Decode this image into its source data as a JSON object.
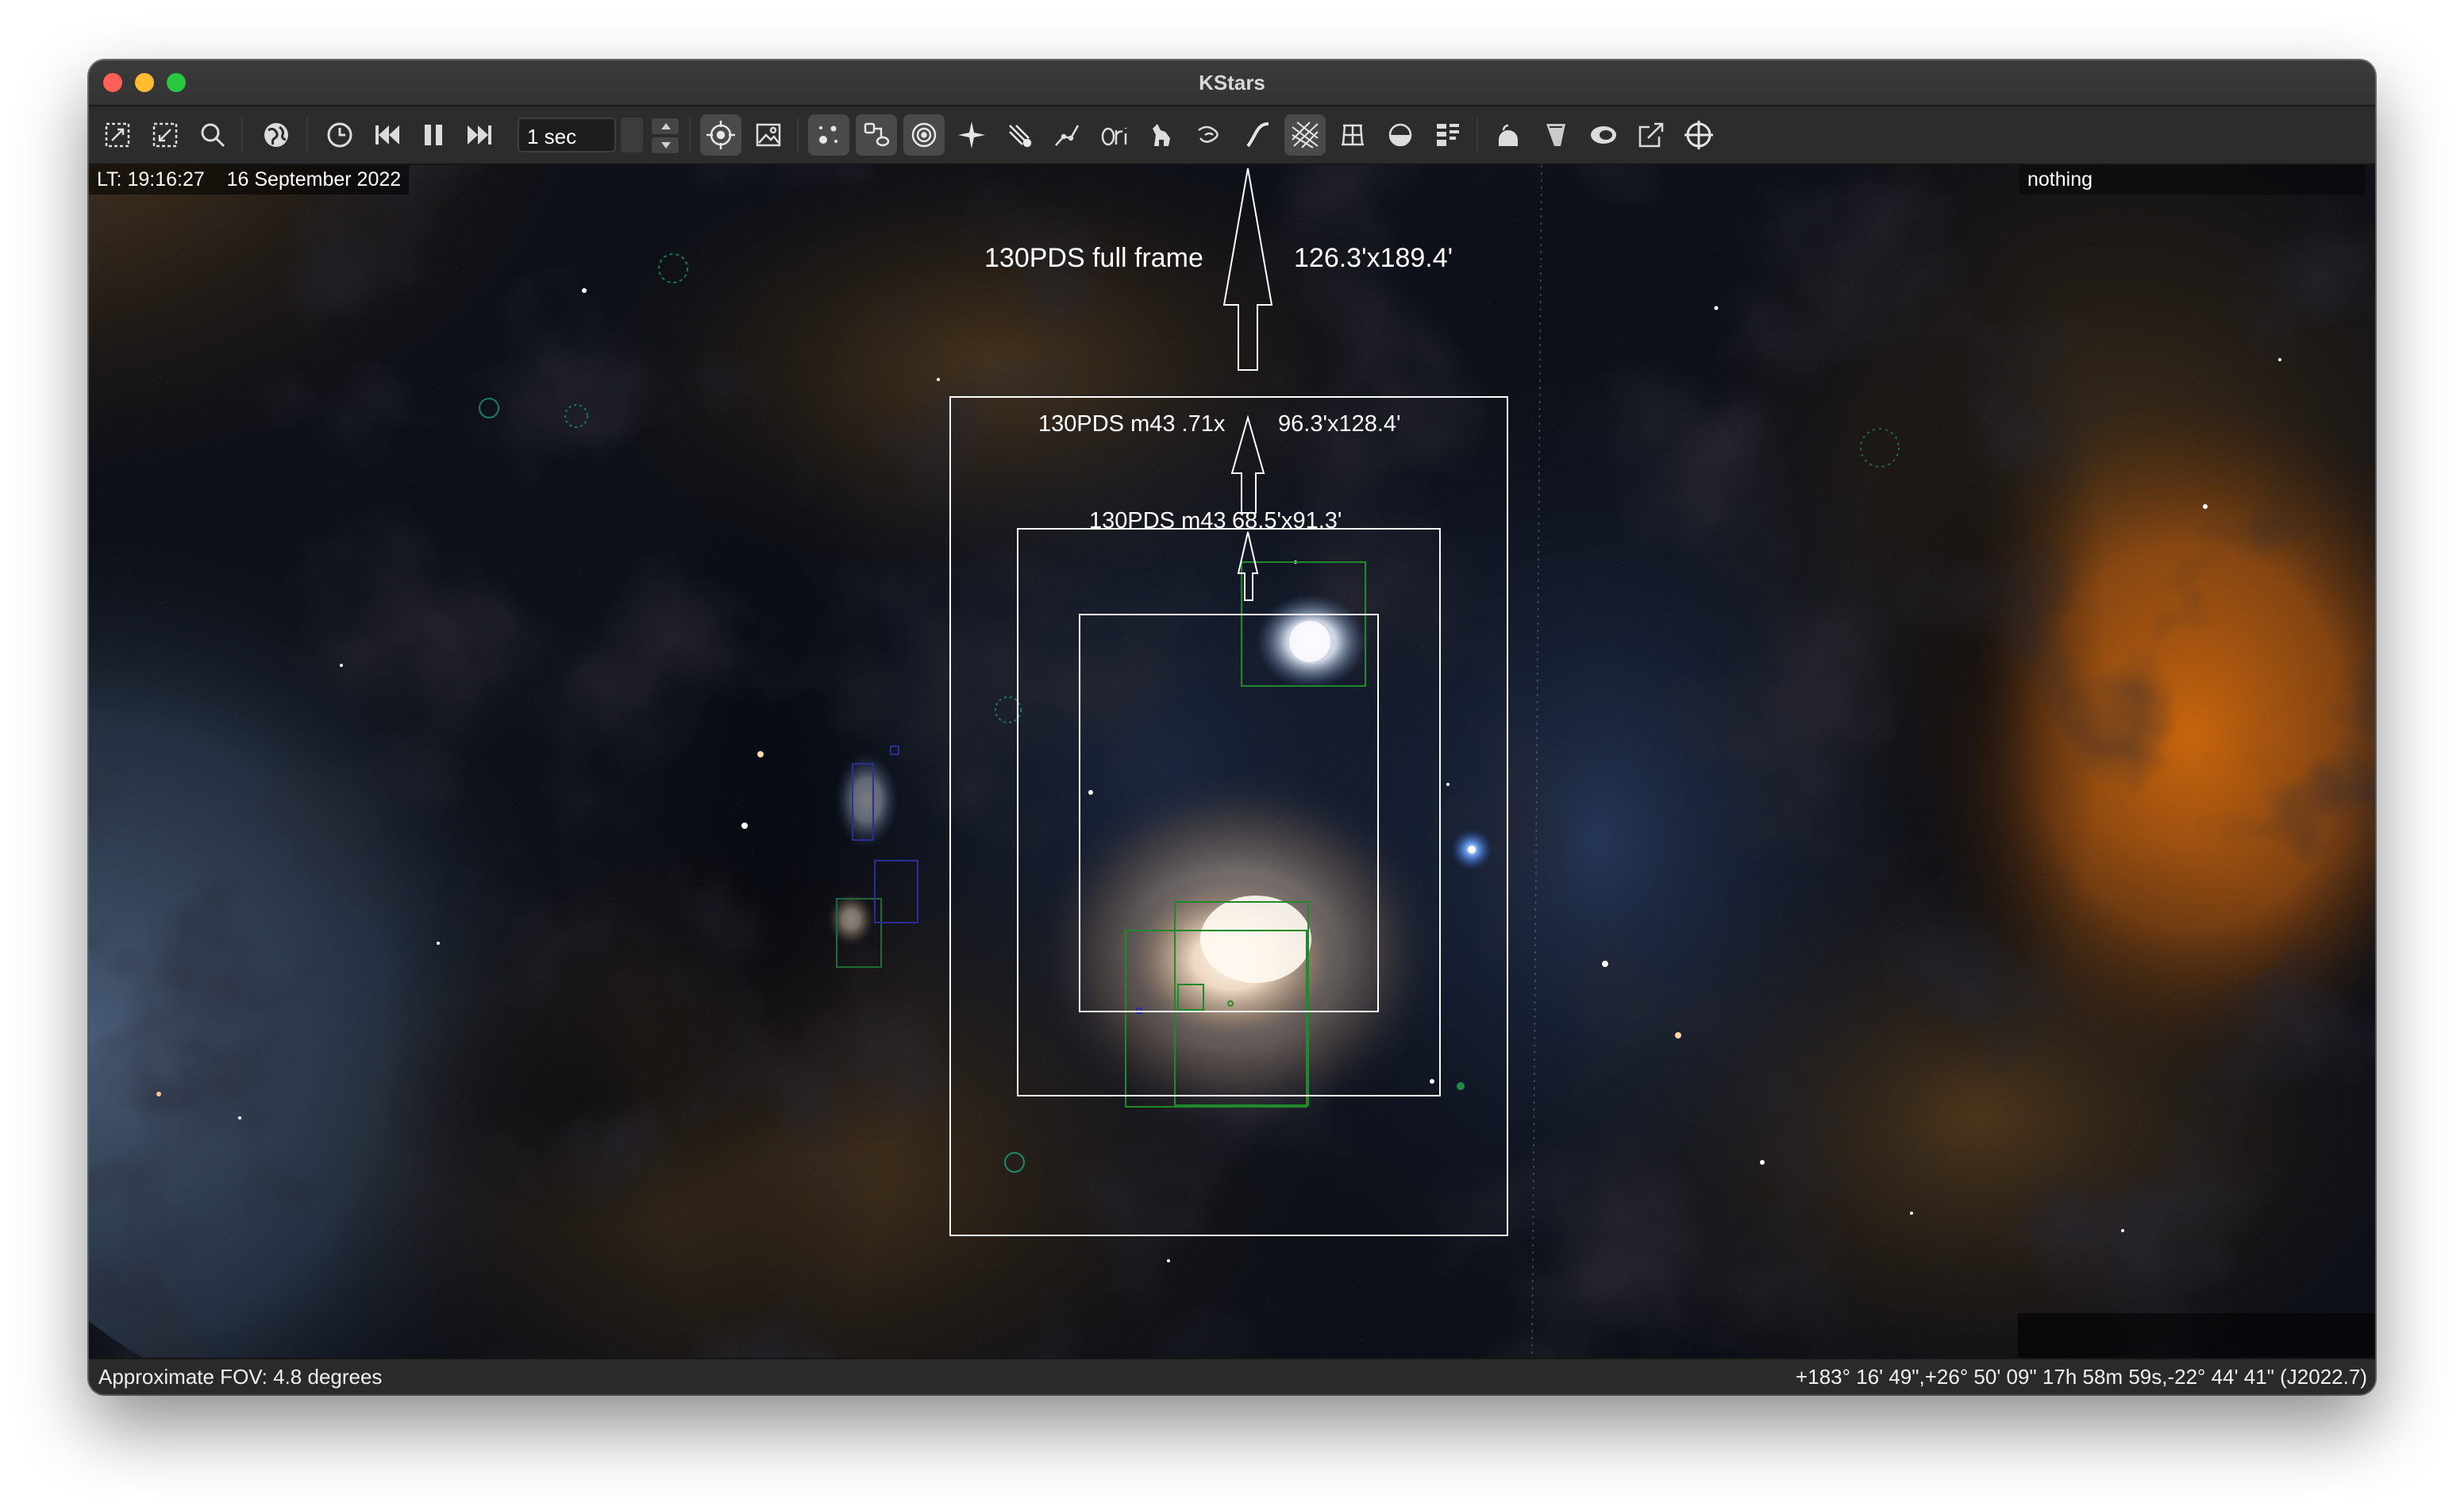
{
  "window": {
    "title": "KStars"
  },
  "toolbar": {
    "time_step": "1 sec",
    "icons": [
      "zoom-fit-icon",
      "zoom-shrink-icon",
      "find-icon",
      "globe-icon",
      "clock-icon",
      "step-backward-icon",
      "pause-icon",
      "step-forward-icon",
      "target-tracking-icon",
      "image-icon",
      "stars-icon",
      "deep-sky-icon",
      "planetary-nebula-icon",
      "solar-system-icon",
      "comets-icon",
      "constellation-lines-icon",
      "constellation-names-icon",
      "constellation-art-icon",
      "milky-way-icon",
      "horizon-icon",
      "equatorial-grid-icon",
      "ground-icon",
      "fov-symbols-icon",
      "hips-icon",
      "supernova-icon",
      "satellites-icon",
      "mosaic-icon",
      "telescope-crosshair-icon"
    ]
  },
  "sky": {
    "time_label": "LT: 19:16:27",
    "date_label": "16 September 2022",
    "focus_object": "nothing",
    "fov_symbols": [
      {
        "name": "130PDS full frame",
        "size": "126.3'x189.4'"
      },
      {
        "name": "130PDS m43 .71x",
        "size": "96.3'x128.4'"
      },
      {
        "name": "130PDS m43",
        "size": "68.5'x91.3'"
      }
    ]
  },
  "status": {
    "fov": "Approximate FOV: 4.8 degrees",
    "coordinates": "+183° 16' 49\",+26° 50' 09\"  17h 58m 59s,-22° 44' 41\" (J2022.7)"
  },
  "colors": {
    "fov_outline": "#ffffff",
    "dso_marker": "#1f8a2a",
    "hii_marker": "#2a2a9a",
    "brown_dust": "#6a4a20",
    "orange_glow": "#b05a10"
  }
}
